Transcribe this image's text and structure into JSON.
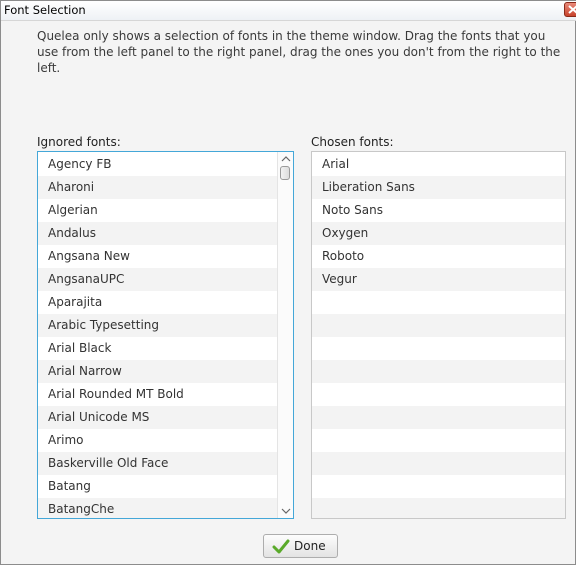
{
  "window": {
    "title": "Font Selection"
  },
  "description": "Quelea only shows a selection of fonts in the theme window. Drag the fonts that you use from the left panel to the right panel, drag the ones you don't from the right to the left.",
  "ignored": {
    "label": "Ignored fonts:",
    "items": [
      "Agency FB",
      "Aharoni",
      "Algerian",
      "Andalus",
      "Angsana New",
      "AngsanaUPC",
      "Aparajita",
      "Arabic Typesetting",
      "Arial Black",
      "Arial Narrow",
      "Arial Rounded MT Bold",
      "Arial Unicode MS",
      "Arimo",
      "Baskerville Old Face",
      "Batang",
      "BatangChe"
    ]
  },
  "chosen": {
    "label": "Chosen fonts:",
    "items": [
      "Arial",
      "Liberation Sans",
      "Noto Sans",
      "Oxygen",
      "Roboto",
      "Vegur",
      "",
      "",
      "",
      "",
      "",
      "",
      "",
      "",
      "",
      ""
    ]
  },
  "done_label": "Done",
  "icons": {
    "close": "close-icon",
    "done": "checkmark-icon"
  },
  "colors": {
    "focus_border": "#44a7d8",
    "check": "#5aaa2a",
    "close": "#c7432c"
  }
}
